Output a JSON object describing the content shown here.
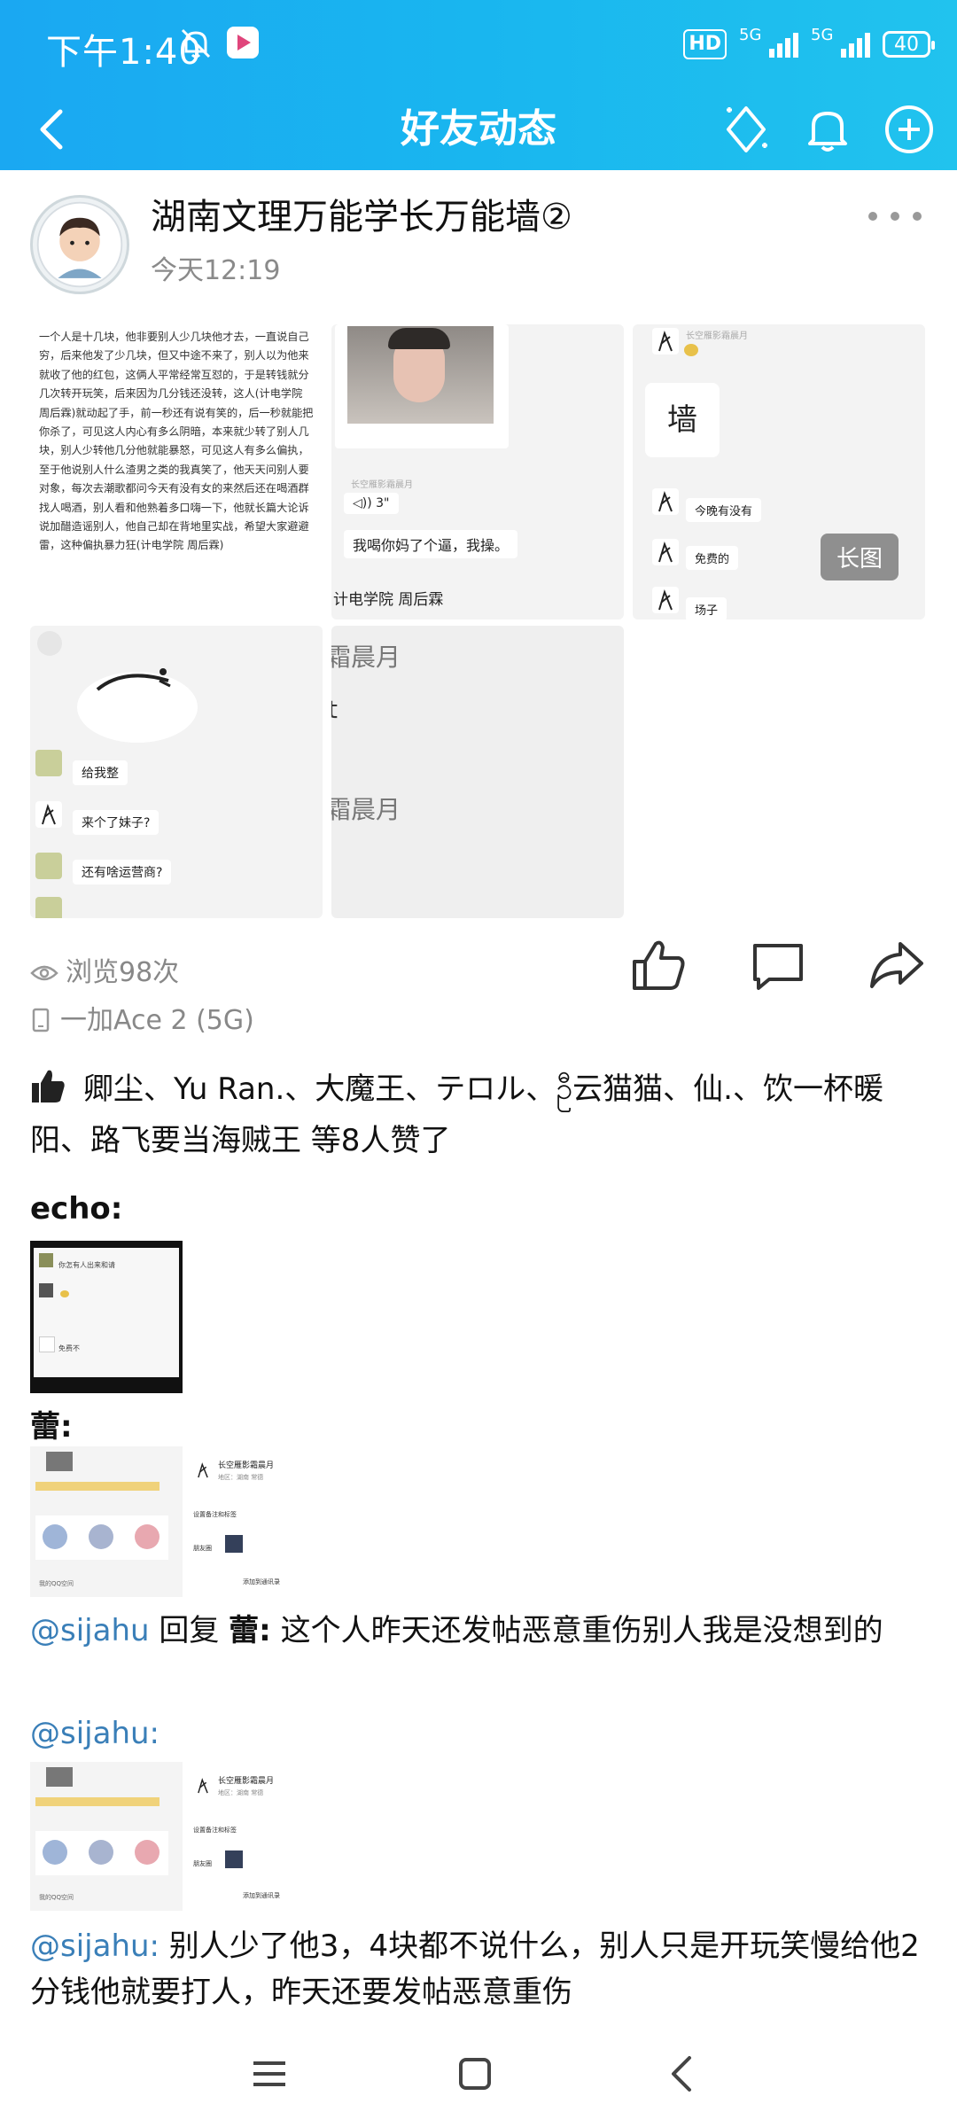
{
  "status_bar": {
    "time": "下午1:40",
    "hd_label": "HD",
    "sim1": "5G",
    "sim2": "5G",
    "battery": "40"
  },
  "nav": {
    "title": "好友动态"
  },
  "post": {
    "author": "湖南文理万能学长万能墙②",
    "time": "今天12:19",
    "images": {
      "essay_text": "一个人是十几块，他非要别人少几块他才去，一直说自己穷，后来他发了少几块，但又中途不来了，别人以为他来就收了他的红包，这俩人平常经常互怼的，于是转钱就分几次转开玩笑，后来因为几分钱还没转，这人(计电学院 周后霖)就动起了手，前一秒还有说有笑的，后一秒就能把你杀了，可见这人内心有多么阴暗，本来就少转了别人几块，别人少转他几分他就能暴怒，可见这人有多么偏执，至于他说别人什么渣男之类的我真笑了，他天天问别人要对象，每次去潮歌都问今天有没有女的来然后还在喝酒群找人喝酒，别人看和他熟着多口嗨一下，他就长篇大论诉说加醋造谣别人，他自己却在背地里实战，希望大家避避雷，这种偏执暴力狂(计电学院 周后霖)",
      "voice_duration": "3\"",
      "chat_msg_1": "我喝你妈了个逼，我操。",
      "chat_caption": "计电学院 周后霖",
      "chat_name_small": "长空雁影霜晨月",
      "wall_label": "墙",
      "msg_tonight": "今晚有没有",
      "msg_free": "免费的",
      "msg_field": "场子",
      "long_image_badge": "长图",
      "msg_give": "给我整",
      "msg_girls": "来个了妹子?",
      "msg_anything": "还有啥运营商?",
      "frag_1": "霜晨月",
      "frag_2": "霜晨月",
      "frag_3": "t"
    },
    "views": "浏览98次",
    "device": "一加Ace 2 (5G)",
    "likes_text": "卿尘、Yu Ran.、大魔王、テロル、ဦ云猫猫、仙.、饮一杯暖阳、路飞要当海贼王 等8人赞了"
  },
  "comments": [
    {
      "name": "echo:"
    },
    {
      "name": "蕾:"
    },
    {
      "at": "@sijahu",
      "reply_word": " 回复 ",
      "target": "蕾:",
      "text": " 这个人昨天还发帖恶意重伤别人我是没想到的"
    },
    {
      "at": "@sijahu:"
    },
    {
      "at": "@sijahu:",
      "text": " 别人少了他3，4块都不说什么，别人只是开玩笑慢给他2分钱他就要打人，昨天还要发帖恶意重伤"
    }
  ],
  "mini_screens": {
    "echo_line1": "你怎有人出来和请",
    "echo_line2": "免费不",
    "profile_name": "长空雁影霜晨月",
    "profile_region": "地区：湖南 常德",
    "profile_tag": "设置备注和标签",
    "profile_friend": "朋友圈",
    "profile_add": "添加到通讯录",
    "profile_qq": "我的QQ空间"
  },
  "colors": {
    "header": "#1aa8f2",
    "link": "#3a7fb8",
    "muted": "#888888"
  }
}
